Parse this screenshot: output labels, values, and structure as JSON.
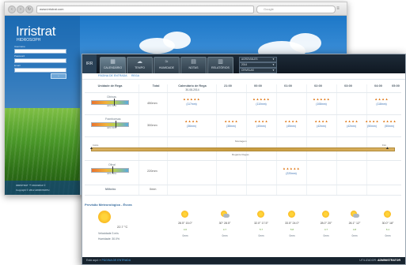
{
  "back_window": {
    "url": "www.irristrat.com",
    "search_placeholder": "Google",
    "brand_title": "Irristrat",
    "brand_subtitle": "HIDROSOPH",
    "fields": [
      {
        "label": "Username"
      },
      {
        "label": "Password"
      },
      {
        "label": "Email"
      }
    ],
    "footer_lines": [
      "IRRISTRAT ™ 2013/2014 ©",
      "Copyright © 2012 HIDROSOPH"
    ]
  },
  "nav": {
    "logo": "IRR",
    "tabs": [
      {
        "label": "CALENDÁRIO",
        "icon": "calendar-icon",
        "active": true
      },
      {
        "label": "TEMPO",
        "icon": "weather-icon",
        "active": false
      },
      {
        "label": "HUMIDADE",
        "icon": "humidity-icon",
        "active": false
      },
      {
        "label": "NOTAS",
        "icon": "notes-icon",
        "active": false
      },
      {
        "label": "RELATÓRIOS",
        "icon": "reports-icon",
        "active": false
      }
    ],
    "selects": [
      "AGROVIALES",
      "2014",
      "CRIVELAS"
    ],
    "sub_links": [
      "PÁGINA DE ENTRADA",
      "REGA"
    ]
  },
  "table": {
    "headers": {
      "unit": "Unidade de Rega",
      "total": "Total",
      "calendar_title": "Calendário de Rega",
      "calendar_date": "30-08-2014",
      "hours": [
        "21:00",
        "00:00",
        "01:00",
        "02:00",
        "03:00",
        "04:00",
        "05:00"
      ]
    },
    "rows": [
      {
        "crop": "Citrinas",
        "total": "450mm",
        "gauge_label": "40% 50%",
        "cells": [
          {
            "col": 0,
            "drops": "▲▲▲▲▲",
            "mm": "(117mm)"
          },
          {
            "col": 2,
            "drops": "▲▲▲▲▲",
            "mm": "(110mm)"
          },
          {
            "col": 5,
            "drops": "▲▲▲▲▲",
            "mm": "(108mm)"
          },
          {
            "col": 7,
            "drops": "▲▲▲▲",
            "mm": "(118mm)"
          }
        ]
      },
      {
        "crop": "Framboesas",
        "total": "300mm",
        "gauge_label": "40% 50%",
        "cells": [
          {
            "col": 0,
            "drops": "▲▲▲▲",
            "mm": "(36mm)"
          },
          {
            "col": 1,
            "drops": "▲▲▲▲",
            "mm": "(38mm)"
          },
          {
            "col": 2,
            "drops": "▲▲▲▲",
            "mm": "(40mm)"
          },
          {
            "col": 3,
            "drops": "▲▲▲▲",
            "mm": "(45mm)"
          },
          {
            "col": 4,
            "drops": "▲▲▲▲",
            "mm": "(42mm)"
          },
          {
            "col": 5,
            "drops": "▲▲▲▲",
            "mm": "(42mm)"
          },
          {
            "col": 6,
            "drops": "▲▲▲▲",
            "mm": "(50mm)"
          },
          {
            "col": 7,
            "drops": "▲▲▲▲",
            "mm": "(50mm)"
          }
        ]
      },
      {
        "crop": "Olival",
        "total": "220mm",
        "gauge_label": "40% 50%",
        "cells": [
          {
            "col": 4,
            "drops": "▲▲▲▲▲",
            "mm": "(220mm)"
          }
        ]
      },
      {
        "crop": "Milheiro",
        "total": "0mm",
        "gauge_label": "",
        "cells": []
      }
    ],
    "band": {
      "top_label": "Montagem",
      "left_label": "Início",
      "right_label": "Fim",
      "mid_label": "Regante Regas"
    }
  },
  "forecast": {
    "title": "Previsão Meteorológica - Évora",
    "now": {
      "temp": "22.7 °C",
      "wind": "Velocidade 3 m/s",
      "humidity": "Humidade: 30.0%"
    },
    "days": [
      {
        "temp": "28.5° 15.0°",
        "rain": "4.6",
        "mm": "0mm",
        "icon": "sun-icon"
      },
      {
        "temp": "30° 28.5°",
        "rain": "4.7",
        "mm": "0mm",
        "icon": "partly-cloudy-icon"
      },
      {
        "temp": "32.0° 17.5°",
        "rain": "5.7",
        "mm": "0mm",
        "icon": "sun-icon"
      },
      {
        "temp": "33.5° 24.0°",
        "rain": "5.8",
        "mm": "0mm",
        "icon": "sun-icon"
      },
      {
        "temp": "28.0° 20°",
        "rain": "4.7",
        "mm": "0mm",
        "icon": "sun-icon"
      },
      {
        "temp": "26.1° 12°",
        "rain": "4.8",
        "mm": "0mm",
        "icon": "partly-cloudy-icon"
      },
      {
        "temp": "30.0° 18°",
        "rain": "6.1",
        "mm": "0mm",
        "icon": "sun-icon"
      }
    ]
  },
  "status": {
    "left_prefix": "Está aqui: »",
    "left_link": "PÁGINA DE ENTRADA",
    "right_prefix": "UTILIZADOR:",
    "right_user": "ADMINISTRATOR"
  }
}
